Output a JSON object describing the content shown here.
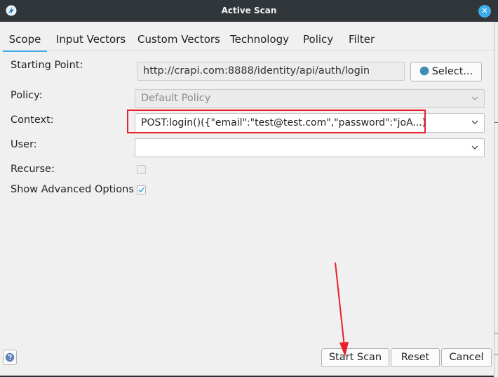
{
  "window": {
    "title": "Active Scan",
    "close_glyph": "✕"
  },
  "tabs": [
    {
      "label": "Scope",
      "active": true
    },
    {
      "label": "Input Vectors"
    },
    {
      "label": "Custom Vectors"
    },
    {
      "label": "Technology"
    },
    {
      "label": "Policy"
    },
    {
      "label": "Filter"
    }
  ],
  "form": {
    "starting_point": {
      "label": "Starting Point:",
      "value": "http://crapi.com:8888/identity/api/auth/login",
      "select_label": "Select..."
    },
    "policy": {
      "label": "Policy:",
      "value": "Default Policy"
    },
    "context": {
      "label": "Context:",
      "value": "POST:login()({\"email\":\"test@test.com\",\"password\":\"joA...)"
    },
    "user": {
      "label": "User:",
      "value": ""
    },
    "recurse": {
      "label": "Recurse:",
      "checked": false
    },
    "advanced": {
      "label": "Show Advanced Options",
      "checked": true
    }
  },
  "buttons": {
    "start": "Start Scan",
    "reset": "Reset",
    "cancel": "Cancel"
  },
  "colors": {
    "accent": "#3daee9",
    "highlight": "#e8202a",
    "titlebar": "#31363b"
  }
}
